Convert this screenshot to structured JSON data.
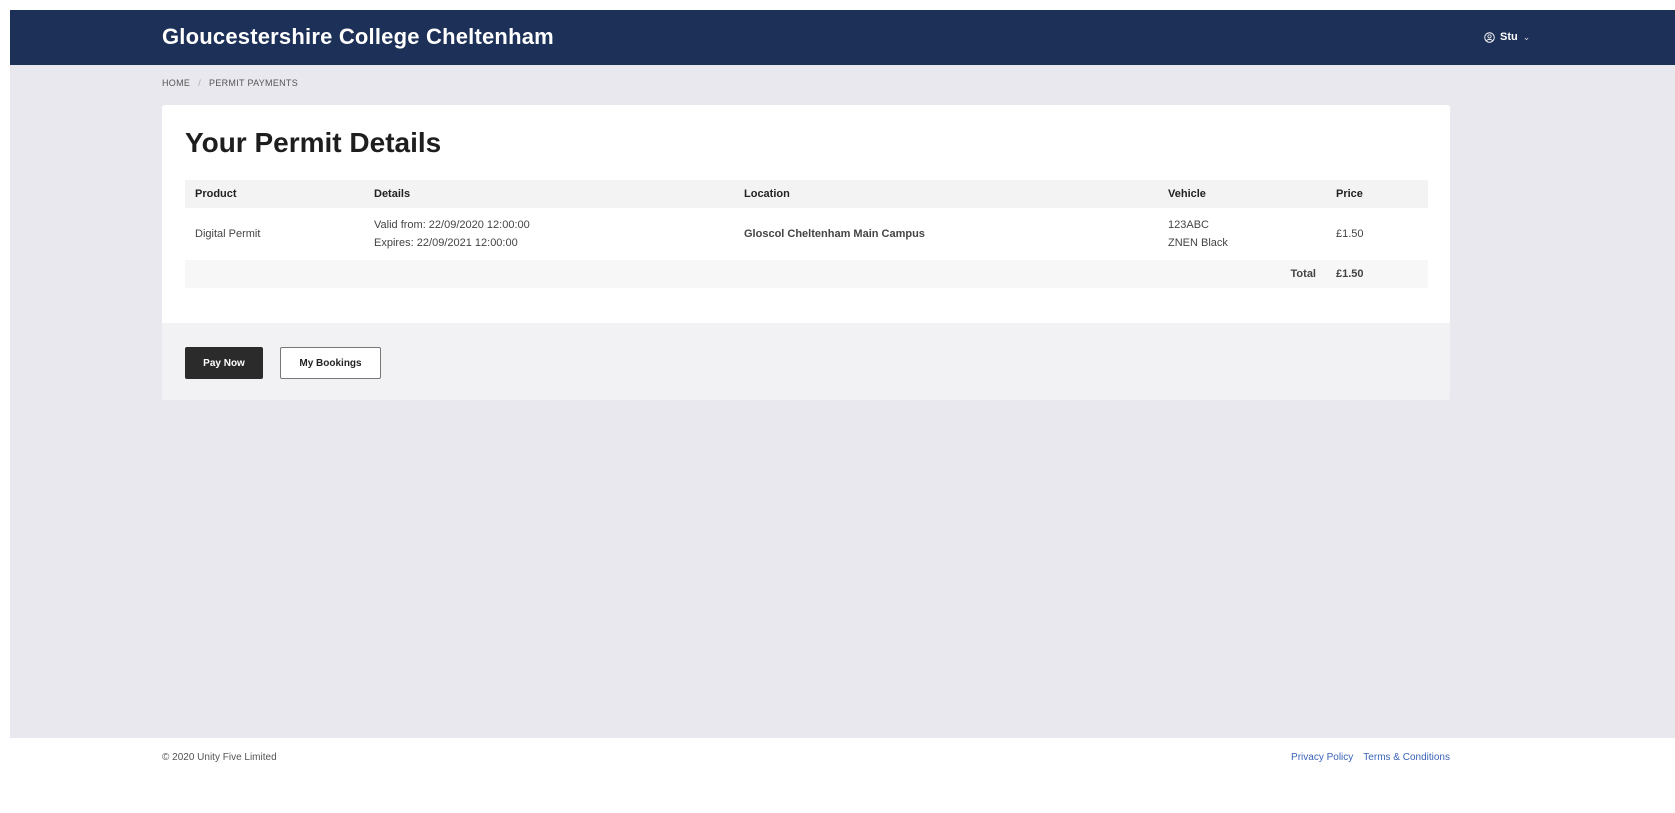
{
  "header": {
    "brand": "Gloucestershire College Cheltenham",
    "user_name": "Stu",
    "user_icon": "user-circle-icon",
    "chevron": "⌄"
  },
  "breadcrumb": {
    "items": [
      "HOME",
      "PERMIT PAYMENTS"
    ],
    "separator": "/"
  },
  "main": {
    "title": "Your Permit Details",
    "table": {
      "columns": [
        "Product",
        "Details",
        "Location",
        "Vehicle",
        "Price"
      ],
      "rows": [
        {
          "product": "Digital Permit",
          "valid_from": "Valid from: 22/09/2020 12:00:00",
          "expires": "Expires: 22/09/2021 12:00:00",
          "location": "Gloscol Cheltenham Main Campus",
          "vehicle_reg": "123ABC",
          "vehicle_desc": "ZNEN Black",
          "price": "£1.50"
        }
      ],
      "total_label": "Total",
      "total_value": "£1.50"
    }
  },
  "actions": {
    "pay_now": "Pay Now",
    "my_bookings": "My Bookings"
  },
  "footer": {
    "copyright": "© 2020 Unity Five Limited",
    "links": [
      "Privacy Policy",
      "Terms & Conditions"
    ]
  },
  "colors": {
    "header_bg": "#1d3057",
    "page_bg": "#e9e8ee",
    "primary_button": "#2b2b2b",
    "link": "#3b63b8"
  }
}
